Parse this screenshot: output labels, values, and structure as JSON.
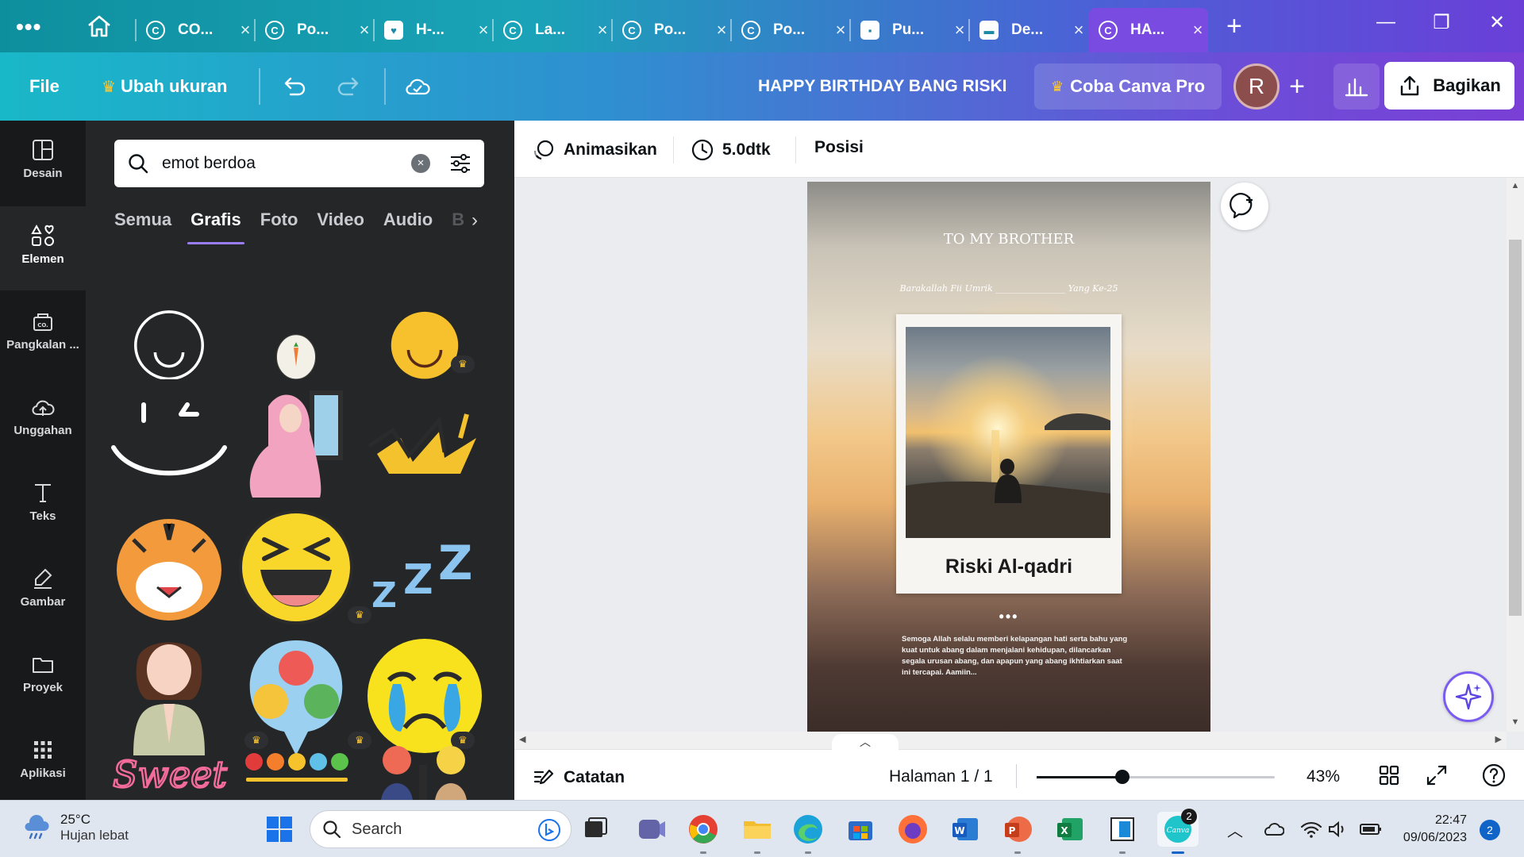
{
  "browser": {
    "tabs": [
      {
        "title": "CO...",
        "icon": "canva-icon"
      },
      {
        "title": "Po...",
        "icon": "canva-icon"
      },
      {
        "title": "H-...",
        "icon": "heart-icon"
      },
      {
        "title": "La...",
        "icon": "canva-icon"
      },
      {
        "title": "Po...",
        "icon": "canva-icon"
      },
      {
        "title": "Po...",
        "icon": "canva-icon"
      },
      {
        "title": "Pu...",
        "icon": "chat-icon"
      },
      {
        "title": "De...",
        "icon": "printer-icon"
      },
      {
        "title": "HA...",
        "icon": "canva-icon",
        "active": true
      }
    ],
    "close_glyph": "×",
    "new_tab_glyph": "+",
    "menu_glyph": "•••"
  },
  "header": {
    "file_label": "File",
    "resize_label": "Ubah ukuran",
    "design_title": "HAPPY BIRTHDAY BANG RISKI",
    "pro_label": "Coba Canva Pro",
    "avatar_initial": "R",
    "share_label": "Bagikan",
    "accent_crown_color": "#ffc933"
  },
  "rail": {
    "items": [
      {
        "label": "Desain",
        "icon": "layout-icon"
      },
      {
        "label": "Elemen",
        "icon": "shapes-icon",
        "active": true
      },
      {
        "label": "Pangkalan ...",
        "icon": "brand-kit-icon"
      },
      {
        "label": "Unggahan",
        "icon": "cloud-upload-icon"
      },
      {
        "label": "Teks",
        "icon": "text-icon"
      },
      {
        "label": "Gambar",
        "icon": "draw-icon"
      },
      {
        "label": "Proyek",
        "icon": "folder-icon"
      },
      {
        "label": "Aplikasi",
        "icon": "apps-grid-icon"
      }
    ]
  },
  "panel": {
    "search_value": "emot berdoa",
    "categories": [
      "Semua",
      "Grafis",
      "Foto",
      "Video",
      "Audio",
      "B"
    ],
    "active_category": "Grafis",
    "crown_badge": "♛",
    "graphics": [
      "smile-arc-graphic",
      "rabbit-carrot-graphic",
      "yellow-smile-graphic",
      "wink-smile-graphic",
      "hijab-girl-graphic",
      "crown-doodle-graphic",
      "tiger-graphic",
      "laughing-emoji-graphic",
      "zzz-graphic",
      "praying-woman-graphic",
      "emotion-bubble-graphic",
      "crying-emoji-graphic",
      "sweet-text-graphic",
      "emoji-scale-graphic",
      "people-emotions-graphic"
    ]
  },
  "toolbar": {
    "animate_label": "Animasikan",
    "duration_label": "5.0dtk",
    "position_label": "Posisi"
  },
  "design": {
    "heading": "TO MY BROTHER",
    "subline": "Barakallah Fii Umrik ________________ Yang Ke-25",
    "photo_caption_name": "Riski Al-qadri",
    "dots": "•••",
    "message": "Semoga Allah selalu memberi kelapangan hati serta bahu yang kuat untuk abang dalam menjalani kehidupan, dilancarkan segala urusan abang, dan apapun yang abang ikhtiarkan saat ini tercapai. Aamiin..."
  },
  "bottom": {
    "notes_label": "Catatan",
    "page_label": "Halaman 1 / 1",
    "zoom_label": "43%",
    "zoom_fraction": 0.36
  },
  "taskbar": {
    "temperature": "25°C",
    "weather": "Hujan lebat",
    "search_label": "Search",
    "time": "22:47",
    "date": "09/06/2023",
    "notification_count": "2",
    "canva_badge": "2"
  }
}
